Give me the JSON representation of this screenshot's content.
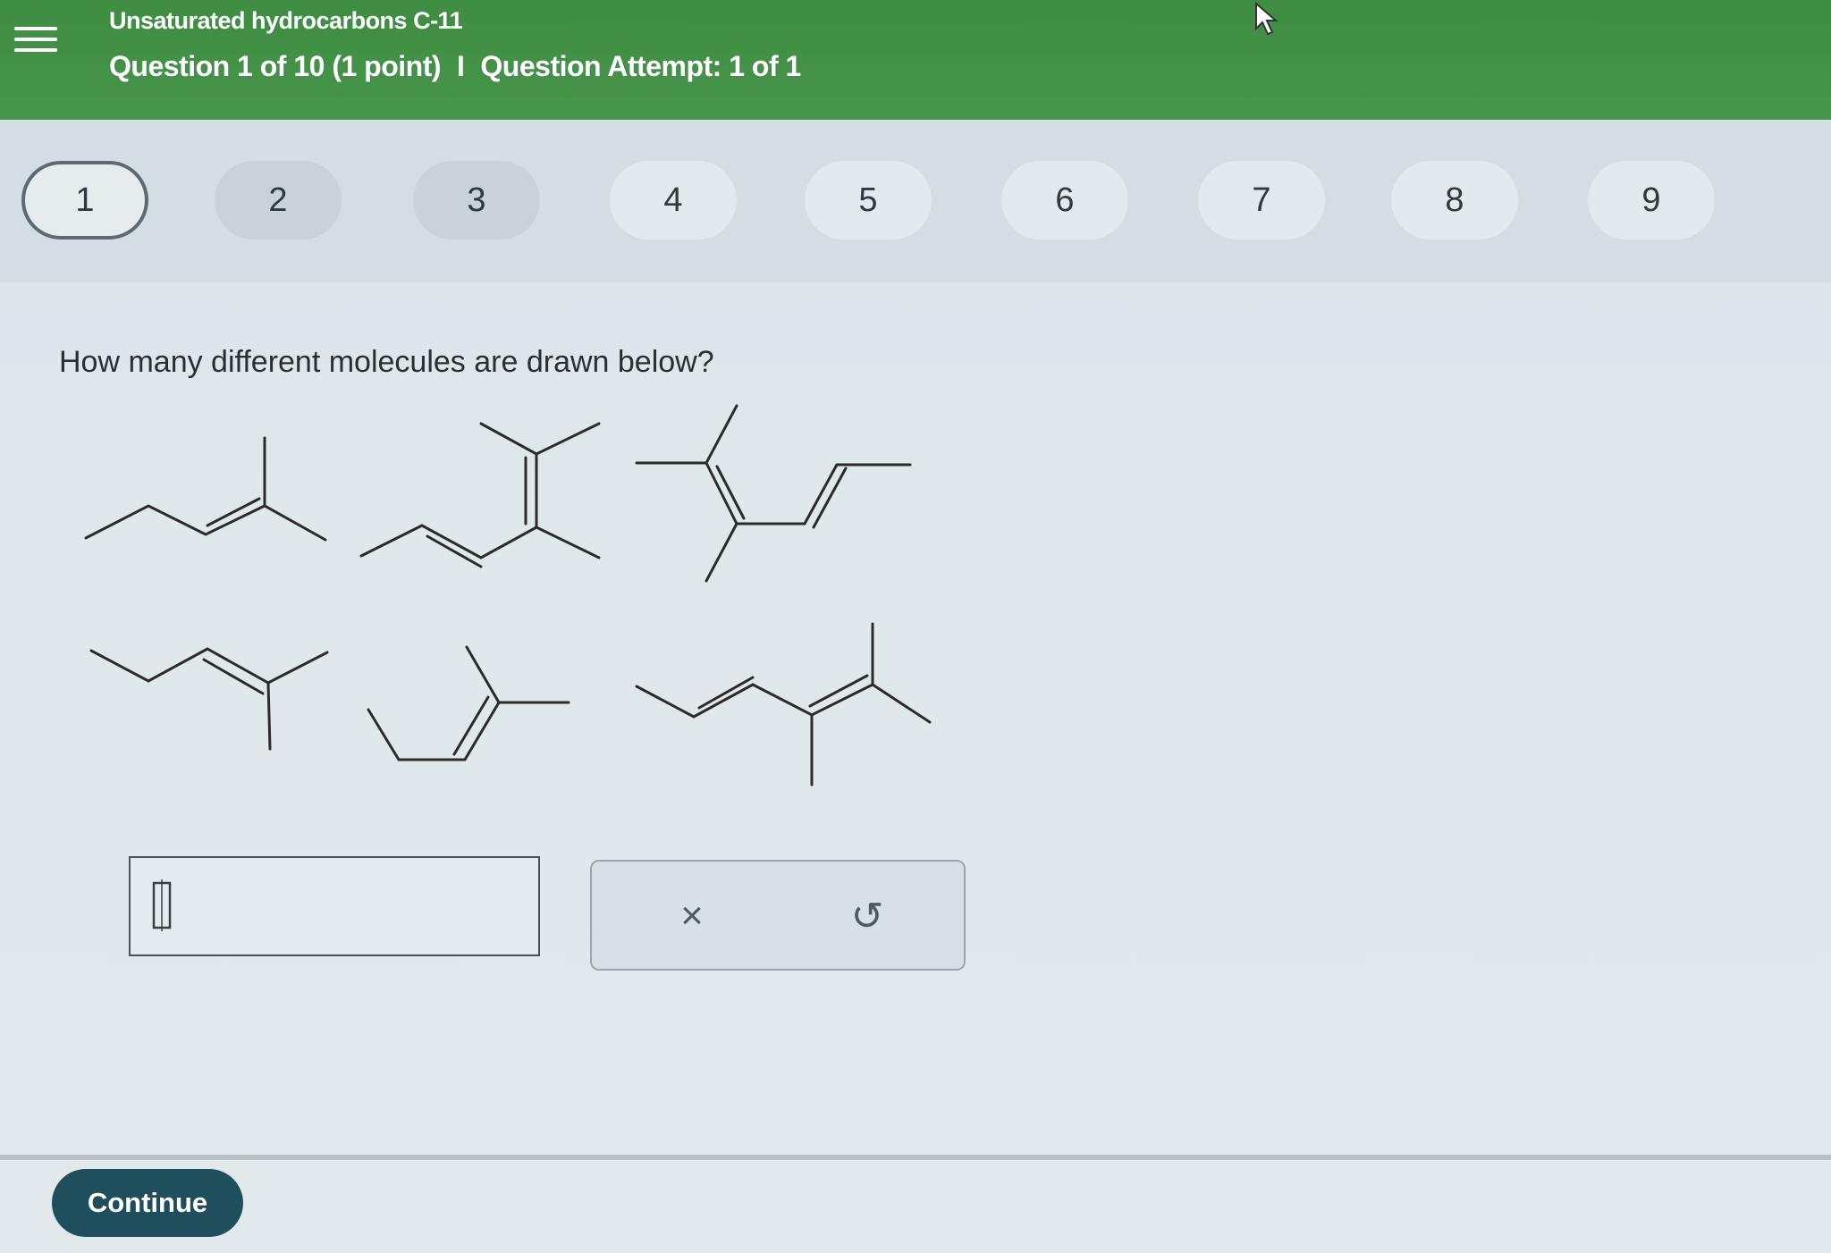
{
  "header": {
    "topic_title": "Unsaturated hydrocarbons C-11",
    "question_counter": "Question 1 of 10 (1 point)",
    "separator": "I",
    "attempt": "Question Attempt: 1 of 1"
  },
  "nav": {
    "items": [
      "1",
      "2",
      "3",
      "4",
      "5",
      "6",
      "7",
      "8",
      "9"
    ],
    "current": "1"
  },
  "question": {
    "prompt": "How many different molecules are drawn below?"
  },
  "answer": {
    "value": "",
    "placeholder": ""
  },
  "tools": {
    "clear_symbol": "×",
    "undo_symbol": "↺"
  },
  "footer": {
    "continue_label": "Continue"
  },
  "colors": {
    "header_green": "#3f8d43",
    "continue_button": "#1f4f5c"
  },
  "icons": {
    "menu": "menu-icon",
    "cursor": "mouse-pointer-icon",
    "clear": "x-icon",
    "undo": "undo-icon"
  }
}
